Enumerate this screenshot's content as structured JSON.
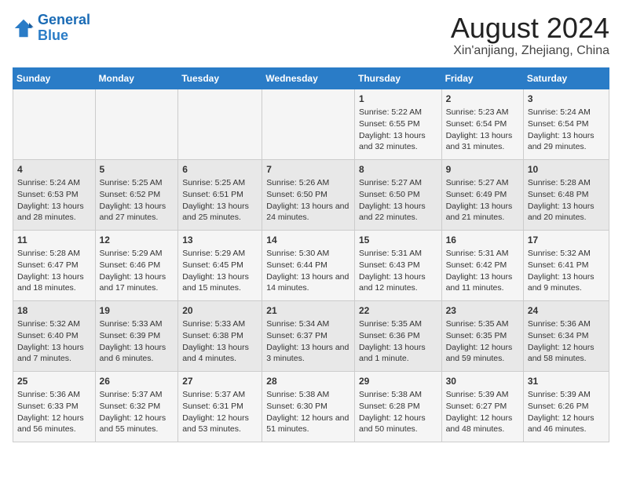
{
  "logo": {
    "line1": "General",
    "line2": "Blue"
  },
  "title": "August 2024",
  "subtitle": "Xin'anjiang, Zhejiang, China",
  "days_of_week": [
    "Sunday",
    "Monday",
    "Tuesday",
    "Wednesday",
    "Thursday",
    "Friday",
    "Saturday"
  ],
  "weeks": [
    [
      {
        "day": "",
        "info": ""
      },
      {
        "day": "",
        "info": ""
      },
      {
        "day": "",
        "info": ""
      },
      {
        "day": "",
        "info": ""
      },
      {
        "day": "1",
        "info": "Sunrise: 5:22 AM\nSunset: 6:55 PM\nDaylight: 13 hours and 32 minutes."
      },
      {
        "day": "2",
        "info": "Sunrise: 5:23 AM\nSunset: 6:54 PM\nDaylight: 13 hours and 31 minutes."
      },
      {
        "day": "3",
        "info": "Sunrise: 5:24 AM\nSunset: 6:54 PM\nDaylight: 13 hours and 29 minutes."
      }
    ],
    [
      {
        "day": "4",
        "info": "Sunrise: 5:24 AM\nSunset: 6:53 PM\nDaylight: 13 hours and 28 minutes."
      },
      {
        "day": "5",
        "info": "Sunrise: 5:25 AM\nSunset: 6:52 PM\nDaylight: 13 hours and 27 minutes."
      },
      {
        "day": "6",
        "info": "Sunrise: 5:25 AM\nSunset: 6:51 PM\nDaylight: 13 hours and 25 minutes."
      },
      {
        "day": "7",
        "info": "Sunrise: 5:26 AM\nSunset: 6:50 PM\nDaylight: 13 hours and 24 minutes."
      },
      {
        "day": "8",
        "info": "Sunrise: 5:27 AM\nSunset: 6:50 PM\nDaylight: 13 hours and 22 minutes."
      },
      {
        "day": "9",
        "info": "Sunrise: 5:27 AM\nSunset: 6:49 PM\nDaylight: 13 hours and 21 minutes."
      },
      {
        "day": "10",
        "info": "Sunrise: 5:28 AM\nSunset: 6:48 PM\nDaylight: 13 hours and 20 minutes."
      }
    ],
    [
      {
        "day": "11",
        "info": "Sunrise: 5:28 AM\nSunset: 6:47 PM\nDaylight: 13 hours and 18 minutes."
      },
      {
        "day": "12",
        "info": "Sunrise: 5:29 AM\nSunset: 6:46 PM\nDaylight: 13 hours and 17 minutes."
      },
      {
        "day": "13",
        "info": "Sunrise: 5:29 AM\nSunset: 6:45 PM\nDaylight: 13 hours and 15 minutes."
      },
      {
        "day": "14",
        "info": "Sunrise: 5:30 AM\nSunset: 6:44 PM\nDaylight: 13 hours and 14 minutes."
      },
      {
        "day": "15",
        "info": "Sunrise: 5:31 AM\nSunset: 6:43 PM\nDaylight: 13 hours and 12 minutes."
      },
      {
        "day": "16",
        "info": "Sunrise: 5:31 AM\nSunset: 6:42 PM\nDaylight: 13 hours and 11 minutes."
      },
      {
        "day": "17",
        "info": "Sunrise: 5:32 AM\nSunset: 6:41 PM\nDaylight: 13 hours and 9 minutes."
      }
    ],
    [
      {
        "day": "18",
        "info": "Sunrise: 5:32 AM\nSunset: 6:40 PM\nDaylight: 13 hours and 7 minutes."
      },
      {
        "day": "19",
        "info": "Sunrise: 5:33 AM\nSunset: 6:39 PM\nDaylight: 13 hours and 6 minutes."
      },
      {
        "day": "20",
        "info": "Sunrise: 5:33 AM\nSunset: 6:38 PM\nDaylight: 13 hours and 4 minutes."
      },
      {
        "day": "21",
        "info": "Sunrise: 5:34 AM\nSunset: 6:37 PM\nDaylight: 13 hours and 3 minutes."
      },
      {
        "day": "22",
        "info": "Sunrise: 5:35 AM\nSunset: 6:36 PM\nDaylight: 13 hours and 1 minute."
      },
      {
        "day": "23",
        "info": "Sunrise: 5:35 AM\nSunset: 6:35 PM\nDaylight: 12 hours and 59 minutes."
      },
      {
        "day": "24",
        "info": "Sunrise: 5:36 AM\nSunset: 6:34 PM\nDaylight: 12 hours and 58 minutes."
      }
    ],
    [
      {
        "day": "25",
        "info": "Sunrise: 5:36 AM\nSunset: 6:33 PM\nDaylight: 12 hours and 56 minutes."
      },
      {
        "day": "26",
        "info": "Sunrise: 5:37 AM\nSunset: 6:32 PM\nDaylight: 12 hours and 55 minutes."
      },
      {
        "day": "27",
        "info": "Sunrise: 5:37 AM\nSunset: 6:31 PM\nDaylight: 12 hours and 53 minutes."
      },
      {
        "day": "28",
        "info": "Sunrise: 5:38 AM\nSunset: 6:30 PM\nDaylight: 12 hours and 51 minutes."
      },
      {
        "day": "29",
        "info": "Sunrise: 5:38 AM\nSunset: 6:28 PM\nDaylight: 12 hours and 50 minutes."
      },
      {
        "day": "30",
        "info": "Sunrise: 5:39 AM\nSunset: 6:27 PM\nDaylight: 12 hours and 48 minutes."
      },
      {
        "day": "31",
        "info": "Sunrise: 5:39 AM\nSunset: 6:26 PM\nDaylight: 12 hours and 46 minutes."
      }
    ]
  ]
}
